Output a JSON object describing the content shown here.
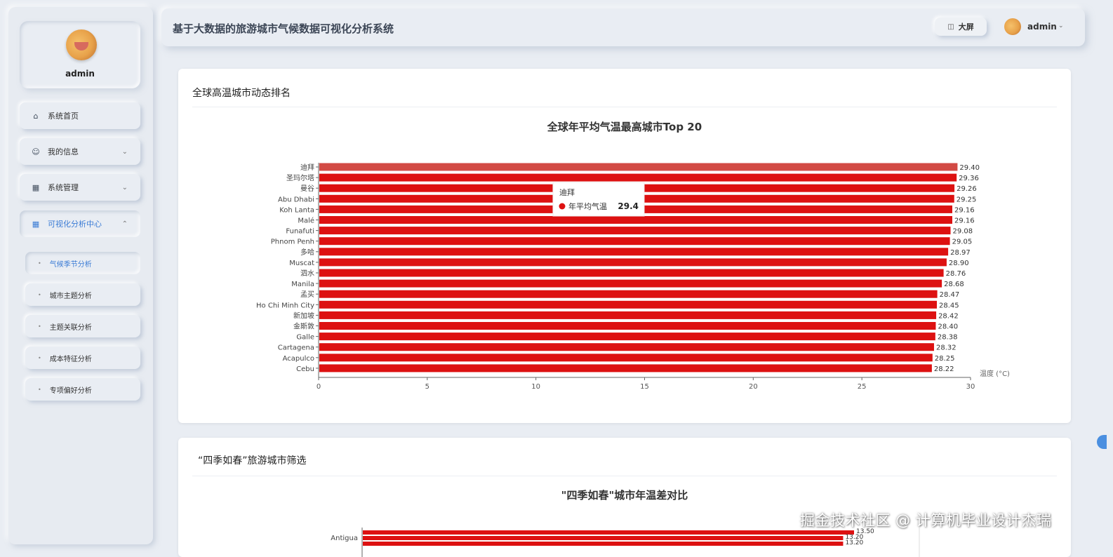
{
  "sidebar": {
    "profile_name": "admin",
    "menu": {
      "home": "系统首页",
      "my_info": "我的信息",
      "system_mgmt": "系统管理",
      "viz_center": "可视化分析中心"
    },
    "sub_items": [
      "气候季节分析",
      "城市主题分析",
      "主题关联分析",
      "成本特征分析",
      "专项偏好分析"
    ]
  },
  "header": {
    "title": "基于大数据的旅游城市气候数据可视化分析系统",
    "bigscreen_label": "大屏",
    "username": "admin"
  },
  "card1": {
    "title": "全球高温城市动态排名",
    "tooltip": {
      "city": "迪拜",
      "series": "年平均气温",
      "value": "29.4"
    }
  },
  "card2": {
    "title": "“四季如春”旅游城市筛选"
  },
  "watermark": "掘金技术社区 @ 计算机毕业设计杰瑞",
  "colors": {
    "bar": "#dd1111",
    "accent": "#3a7bd5"
  },
  "chart_data": [
    {
      "type": "bar",
      "orientation": "horizontal",
      "title": "全球年平均气温最高城市Top 20",
      "xlabel": "温度 (°C)",
      "xlim": [
        0,
        30
      ],
      "xticks": [
        0,
        5,
        10,
        15,
        20,
        25,
        30
      ],
      "categories": [
        "迪拜",
        "圣玛尔塔",
        "曼谷",
        "Abu Dhabi",
        "Koh Lanta",
        "Malé",
        "Funafuti",
        "Phnom Penh",
        "多哈",
        "Muscat",
        "泗水",
        "Manila",
        "孟买",
        "Ho Chi Minh City",
        "新加坡",
        "金斯敦",
        "Galle",
        "Cartagena",
        "Acapulco",
        "Cebu"
      ],
      "values": [
        29.4,
        29.36,
        29.26,
        29.25,
        29.16,
        29.16,
        29.08,
        29.05,
        28.97,
        28.9,
        28.76,
        28.68,
        28.47,
        28.45,
        28.42,
        28.4,
        28.38,
        28.32,
        28.25,
        28.22
      ],
      "labels": [
        "29.40",
        "29.36",
        "29.26",
        "29.25",
        "29.16",
        "29.16",
        "29.08",
        "29.05",
        "28.97",
        "28.90",
        "28.76",
        "28.68",
        "28.47",
        "28.45",
        "28.42",
        "28.40",
        "28.38",
        "28.32",
        "28.25",
        "28.22"
      ],
      "grid": false
    },
    {
      "type": "bar",
      "orientation": "horizontal",
      "title": "\"四季如春\"城市年温差对比",
      "categories": [
        "Antigua"
      ],
      "values": [
        13.5,
        13.2,
        13.2
      ],
      "labels": [
        "13.50",
        "13.20",
        "13.20"
      ]
    }
  ]
}
